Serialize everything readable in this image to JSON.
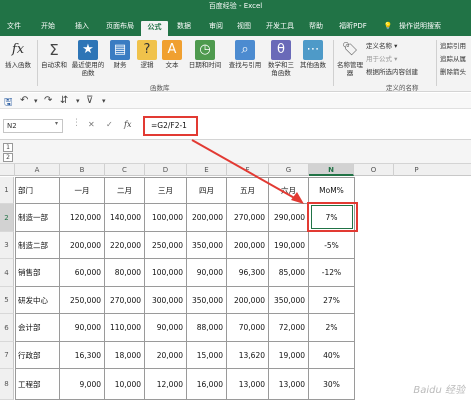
{
  "window": {
    "title": "百度经验 - Excel"
  },
  "tabs": [
    {
      "label": "文件"
    },
    {
      "label": "开始"
    },
    {
      "label": "插入"
    },
    {
      "label": "页面布局"
    },
    {
      "label": "公式"
    },
    {
      "label": "数据"
    },
    {
      "label": "审阅"
    },
    {
      "label": "视图"
    },
    {
      "label": "开发工具"
    },
    {
      "label": "帮助"
    },
    {
      "label": "福昕PDF"
    },
    {
      "label": "操作说明搜索"
    }
  ],
  "ribbon": {
    "buttons": [
      {
        "label": "插入函数",
        "icon": "fx-icon"
      },
      {
        "label": "自动求和",
        "icon": "sum-icon"
      },
      {
        "label": "最近使用的函数",
        "icon": "star-icon"
      },
      {
        "label": "财务",
        "icon": "book-icon"
      },
      {
        "label": "逻辑",
        "icon": "question-icon"
      },
      {
        "label": "文本",
        "icon": "text-icon"
      },
      {
        "label": "日期和时间",
        "icon": "clock-icon"
      },
      {
        "label": "查找与引用",
        "icon": "search-icon"
      },
      {
        "label": "数学和三角函数",
        "icon": "theta-icon"
      },
      {
        "label": "其他函数",
        "icon": "more-icon"
      },
      {
        "label": "名称管理器",
        "icon": "tag-icon"
      }
    ],
    "group_function_library": "函数库",
    "group_defined_names": "定义的名称",
    "defined_names_items": [
      "定义名称 ▾",
      "用于公式 ▾",
      "根据所选内容创建"
    ],
    "right_items": [
      "追踪引用",
      "追踪从属",
      "删除箭头"
    ]
  },
  "formula_bar": {
    "name_box": "N2",
    "formula": "=G2/F2-1",
    "fx_label": "fx"
  },
  "outline_levels": [
    "1",
    "2"
  ],
  "columns": [
    "A",
    "B",
    "C",
    "D",
    "E",
    "F",
    "G",
    "N",
    "O",
    "P"
  ],
  "rows": [
    "1",
    "2",
    "3",
    "4",
    "5",
    "6",
    "7",
    "8"
  ],
  "table": {
    "headers": [
      "部门",
      "一月",
      "二月",
      "三月",
      "四月",
      "五月",
      "六月",
      "MoM%"
    ],
    "data": [
      [
        "制造一部",
        "120,000",
        "140,000",
        "100,000",
        "200,000",
        "270,000",
        "290,000",
        "7%"
      ],
      [
        "制造二部",
        "200,000",
        "220,000",
        "250,000",
        "350,000",
        "200,000",
        "190,000",
        "-5%"
      ],
      [
        "销售部",
        "60,000",
        "80,000",
        "100,000",
        "90,000",
        "96,300",
        "85,000",
        "-12%"
      ],
      [
        "研发中心",
        "250,000",
        "270,000",
        "300,000",
        "350,000",
        "200,000",
        "350,000",
        "27%"
      ],
      [
        "会计部",
        "90,000",
        "110,000",
        "90,000",
        "88,000",
        "70,000",
        "72,000",
        "2%"
      ],
      [
        "行政部",
        "16,300",
        "18,000",
        "20,000",
        "15,000",
        "13,620",
        "19,000",
        "40%"
      ],
      [
        "工程部",
        "9,000",
        "10,000",
        "12,000",
        "16,000",
        "13,000",
        "13,000",
        "30%"
      ]
    ]
  },
  "watermark": "Baidu 经验",
  "colors": {
    "accent": "#217346",
    "highlight": "#e23a33"
  }
}
